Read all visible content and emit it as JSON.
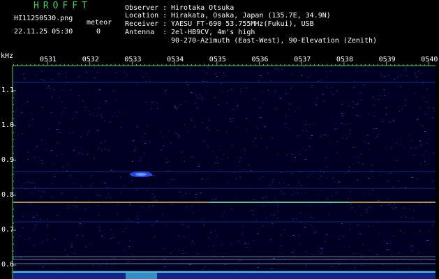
{
  "header": {
    "app_title": "HROFFT",
    "filename": "HI11250530.png",
    "meteor_label": "meteor",
    "meteor_count": "0",
    "datetime": "22.11.25 05:30",
    "observer_label": "Observer :",
    "observer_value": "Hirotaka Otsuka",
    "location_label": "Location :",
    "location_value": "Hirakata, Osaka, Japan (135.7E, 34.9N)",
    "receiver_label": "Receiver :",
    "receiver_value": "YAESU FT-690 53.755MHz(Fukui), USB",
    "antenna_label": "Antenna  :",
    "antenna_value": "2el-HB9CV, 4m's high",
    "antenna_value2": "90-270-Azimuth (East-West), 90-Elevation (Zenith)"
  },
  "axes": {
    "y_unit": "kHz",
    "y_ticks": [
      "1.1",
      "1.0",
      "0.9",
      "0.8",
      "0.7",
      "0.6"
    ],
    "y_tick_values": [
      1.1,
      1.0,
      0.9,
      0.8,
      0.7,
      0.6
    ],
    "x_ticks": [
      "0531",
      "0532",
      "0533",
      "0534",
      "0535",
      "0536",
      "0537",
      "0538",
      "0539",
      "0540"
    ]
  },
  "colors": {
    "background": "#000022",
    "axis": "#3fd64a",
    "tick_labels": "#ffffff",
    "signal_band": "#e8c23a",
    "noise": "#2233aa"
  }
}
